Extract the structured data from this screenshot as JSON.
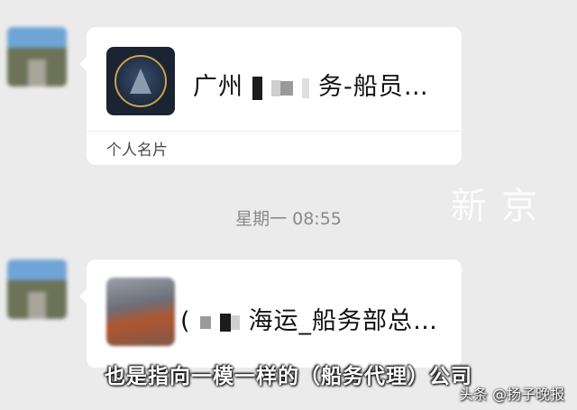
{
  "messages": [
    {
      "card_title_prefix": "广州",
      "card_title_suffix": "务-船员…",
      "card_type": "个人名片"
    },
    {
      "card_title_prefix": "(",
      "card_title_suffix": "海运_船务部总…"
    }
  ],
  "timestamp": "星期一 08:55",
  "watermark": "新京",
  "subtitle": "也是指向一模一样的（船务代理）公司",
  "source_credit": "头条 @扬子晚报"
}
